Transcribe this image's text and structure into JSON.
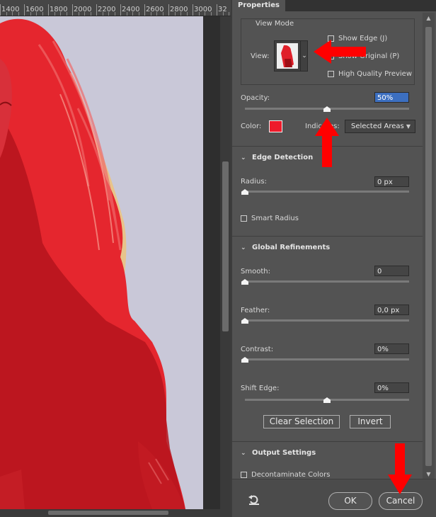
{
  "ruler": {
    "labels": [
      "1400",
      "1600",
      "1800",
      "2000",
      "2200",
      "2400",
      "2600",
      "2800",
      "3000",
      "32"
    ]
  },
  "properties": {
    "tab_title": "Properties",
    "view_mode": {
      "header": "View Mode",
      "view_label": "View:",
      "show_edge": "Show Edge (J)",
      "show_original": "Show Original (P)",
      "high_quality_preview": "High Quality Preview"
    },
    "opacity": {
      "label": "Opacity:",
      "value": "50%",
      "level": 0.5
    },
    "color": {
      "label": "Color:",
      "swatch": "#ee1b2b"
    },
    "indicates": {
      "label": "Indicates:",
      "value": "Selected Areas"
    },
    "edge_detection": {
      "header": "Edge Detection",
      "radius_label": "Radius:",
      "radius_value": "0 px",
      "radius_level": 0,
      "smart_radius": "Smart Radius"
    },
    "global_refinements": {
      "header": "Global Refinements",
      "smooth_label": "Smooth:",
      "smooth_value": "0",
      "smooth_level": 0,
      "feather_label": "Feather:",
      "feather_value": "0,0 px",
      "feather_level": 0,
      "contrast_label": "Contrast:",
      "contrast_value": "0%",
      "contrast_level": 0,
      "shift_edge_label": "Shift Edge:",
      "shift_edge_value": "0%",
      "shift_edge_level": 0.5,
      "clear_selection": "Clear Selection",
      "invert": "Invert"
    },
    "output_settings": {
      "header": "Output Settings",
      "decontaminate": "Decontaminate Colors"
    },
    "footer": {
      "ok": "OK",
      "cancel": "Cancel"
    }
  },
  "colors": {
    "overlay_red": "#e5262e",
    "background": "#c9c8d8",
    "annotation_arrow": "#ff0000"
  }
}
